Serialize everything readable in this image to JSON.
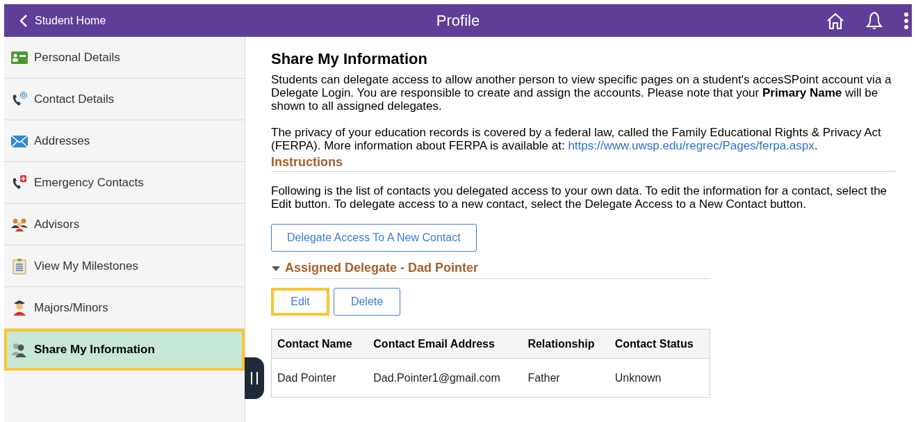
{
  "header": {
    "back": "Student Home",
    "title": "Profile"
  },
  "sidebar": {
    "items": [
      {
        "label": "Personal Details",
        "selected": false,
        "highlighted": false
      },
      {
        "label": "Contact Details",
        "selected": false,
        "highlighted": false
      },
      {
        "label": "Addresses",
        "selected": false,
        "highlighted": false
      },
      {
        "label": "Emergency Contacts",
        "selected": false,
        "highlighted": false
      },
      {
        "label": "Advisors",
        "selected": false,
        "highlighted": false
      },
      {
        "label": "View My Milestones",
        "selected": false,
        "highlighted": false
      },
      {
        "label": "Majors/Minors",
        "selected": false,
        "highlighted": false
      },
      {
        "label": "Share My Information",
        "selected": true,
        "highlighted": true
      }
    ]
  },
  "content": {
    "title": "Share My Information",
    "intro": "Students can delegate access to allow another person to view specific pages on a student's accesSPoint account via a Delegate Login. You are responsible to create and assign the accounts. Please note that your **Primary Name** will be shown to all assigned delegates.",
    "privacy": {
      "text": "The privacy of your education records is covered by a federal law, called the Family Educational Rights & Privacy Act (FERPA). More information about FERPA is available at: ",
      "link": "https://www.uwsp.edu/regrec/Pages/ferpa.aspx",
      "after": "."
    },
    "instructions_heading": "Instructions",
    "instructions": "Following is the list of contacts you delegated access to your own data. To edit the information for a contact, select the Edit button. To delegate access to a new contact, select the Delegate Access to a New Contact button.",
    "new_button": "Delegate Access To A New Contact",
    "delegate": {
      "heading": "Assigned Delegate - Dad Pointer",
      "expanded": true,
      "buttons": [
        {
          "label": "Edit",
          "highlighted": true
        },
        {
          "label": "Delete",
          "highlighted": false
        }
      ],
      "table": {
        "columns": [
          "Contact Name",
          "Contact Email Address",
          "Relationship",
          "Contact Status"
        ],
        "rows": [
          [
            "Dad Pointer",
            "Dad.Pointer1@gmail.com",
            "Father",
            "Unknown"
          ]
        ]
      }
    }
  }
}
